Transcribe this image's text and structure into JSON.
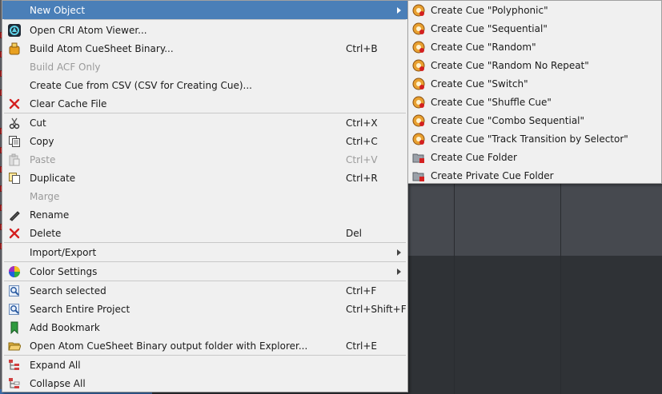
{
  "main_menu": {
    "items": [
      {
        "label": "New Object",
        "shortcut": "",
        "icon": "none",
        "submenu": true,
        "highlighted": true,
        "disabled": false
      },
      {
        "label": "Open CRI Atom Viewer...",
        "shortcut": "",
        "icon": "atom-viewer-icon",
        "disabled": false
      },
      {
        "label": "Build Atom CueSheet Binary...",
        "shortcut": "Ctrl+B",
        "icon": "build-icon",
        "disabled": false
      },
      {
        "label": "Build ACF Only",
        "shortcut": "",
        "icon": "none",
        "disabled": true
      },
      {
        "label": "Create Cue from CSV (CSV for Creating Cue)...",
        "shortcut": "",
        "icon": "none",
        "disabled": false
      },
      {
        "label": "Clear Cache File",
        "shortcut": "",
        "icon": "red-x-icon",
        "disabled": false
      },
      {
        "label": "Cut",
        "shortcut": "Ctrl+X",
        "icon": "scissors-icon",
        "disabled": false
      },
      {
        "label": "Copy",
        "shortcut": "Ctrl+C",
        "icon": "copy-icon",
        "disabled": false
      },
      {
        "label": "Paste",
        "shortcut": "Ctrl+V",
        "icon": "paste-icon",
        "disabled": true
      },
      {
        "label": "Duplicate",
        "shortcut": "Ctrl+R",
        "icon": "duplicate-icon",
        "disabled": false
      },
      {
        "label": "Marge",
        "shortcut": "",
        "icon": "none",
        "disabled": true
      },
      {
        "label": "Rename",
        "shortcut": "",
        "icon": "pencil-icon",
        "disabled": false
      },
      {
        "label": "Delete",
        "shortcut": "Del",
        "icon": "red-x-icon",
        "disabled": false
      },
      {
        "label": "Import/Export",
        "shortcut": "",
        "icon": "none",
        "submenu": true,
        "disabled": false
      },
      {
        "label": "Color Settings",
        "shortcut": "",
        "icon": "color-wheel-icon",
        "submenu": true,
        "disabled": false
      },
      {
        "label": "Search selected",
        "shortcut": "Ctrl+F",
        "icon": "search-icon",
        "disabled": false
      },
      {
        "label": "Search Entire Project",
        "shortcut": "Ctrl+Shift+F",
        "icon": "search-icon",
        "disabled": false
      },
      {
        "label": "Add Bookmark",
        "shortcut": "",
        "icon": "bookmark-icon",
        "disabled": false
      },
      {
        "label": "Open Atom CueSheet Binary output folder with Explorer...",
        "shortcut": "Ctrl+E",
        "icon": "folder-open-icon",
        "disabled": false
      },
      {
        "label": "Expand All",
        "shortcut": "",
        "icon": "expand-tree-icon",
        "disabled": false
      },
      {
        "label": "Collapse All",
        "shortcut": "",
        "icon": "collapse-tree-icon",
        "disabled": false
      }
    ]
  },
  "sub_menu": {
    "items": [
      {
        "label": "Create Cue \"Polyphonic\"",
        "icon": "cue-icon"
      },
      {
        "label": "Create Cue \"Sequential\"",
        "icon": "cue-icon"
      },
      {
        "label": "Create Cue \"Random\"",
        "icon": "cue-icon"
      },
      {
        "label": "Create Cue \"Random No Repeat\"",
        "icon": "cue-icon"
      },
      {
        "label": "Create Cue \"Switch\"",
        "icon": "cue-icon"
      },
      {
        "label": "Create Cue \"Shuffle Cue\"",
        "icon": "cue-icon"
      },
      {
        "label": "Create Cue \"Combo Sequential\"",
        "icon": "cue-icon"
      },
      {
        "label": "Create Cue \"Track Transition by Selector\"",
        "icon": "cue-icon"
      },
      {
        "label": "Create Cue Folder",
        "icon": "cue-folder-icon"
      },
      {
        "label": "Create Private Cue Folder",
        "icon": "cue-folder-icon"
      }
    ]
  },
  "colors": {
    "highlight": "#4a7fb8",
    "menu_bg": "#f0f0f0",
    "disabled_text": "#9a9a9a"
  }
}
